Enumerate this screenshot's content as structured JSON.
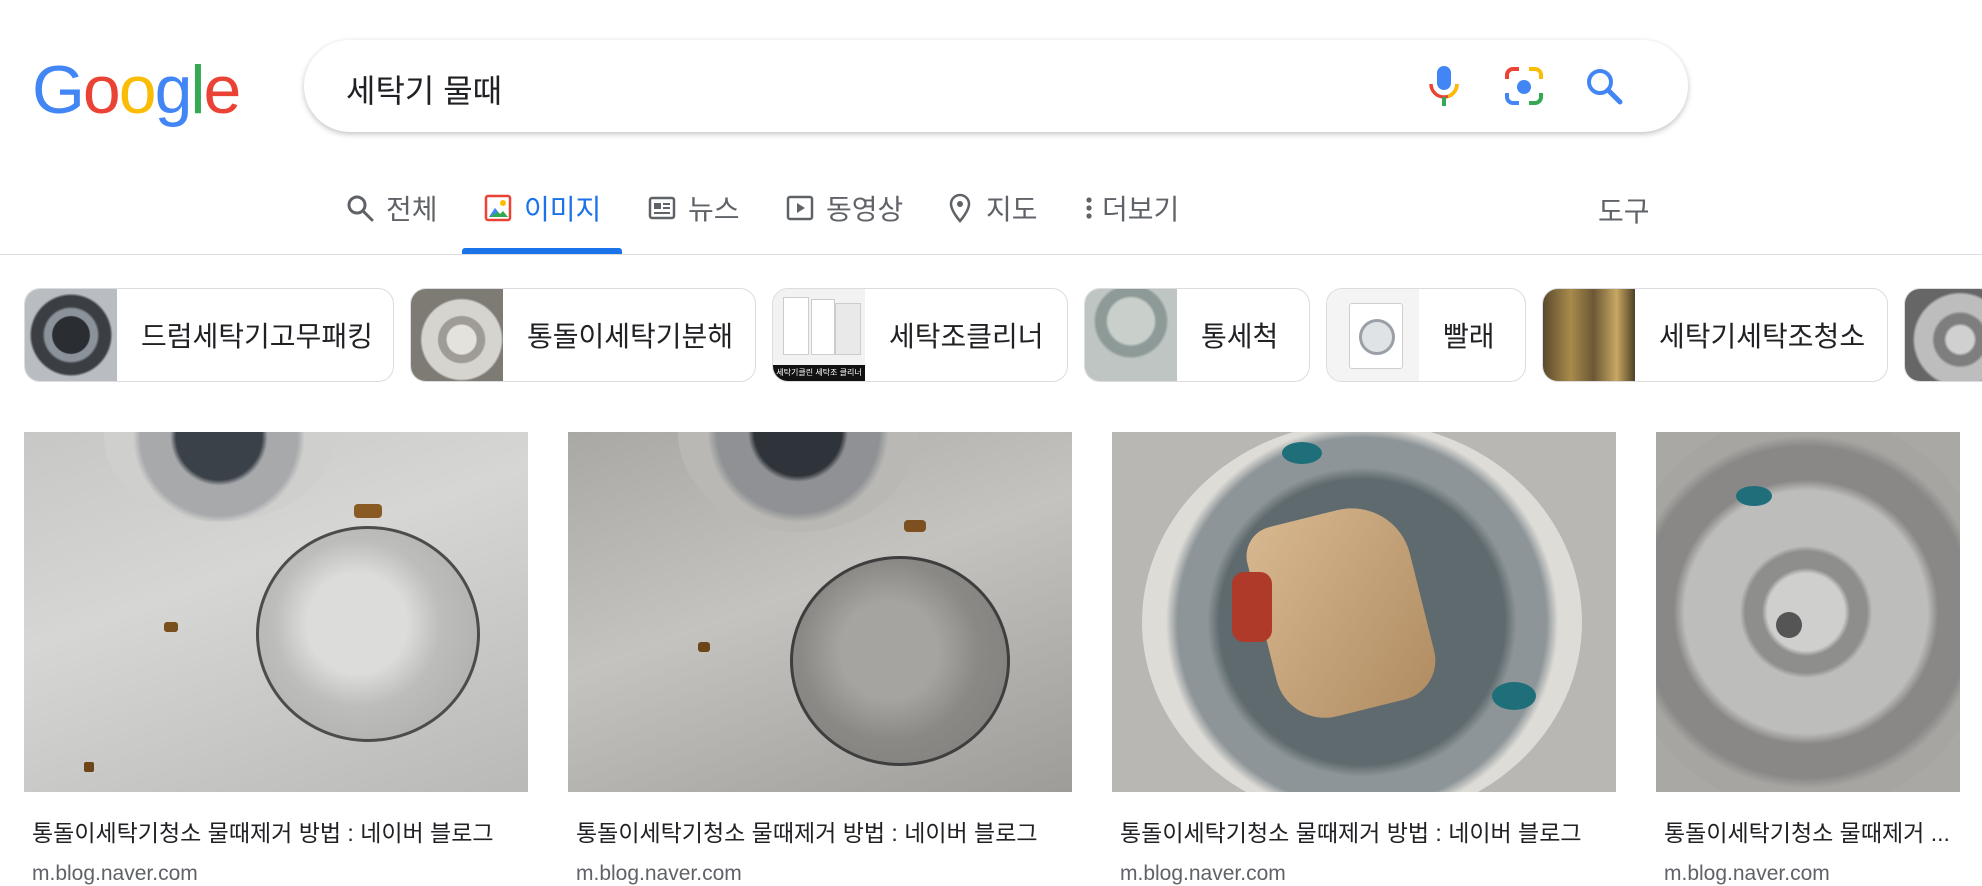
{
  "logo": {
    "letters": [
      "G",
      "o",
      "o",
      "g",
      "l",
      "e"
    ],
    "colors": [
      "#4285F4",
      "#EA4335",
      "#FBBC05",
      "#4285F4",
      "#34A853",
      "#EA4335"
    ]
  },
  "search": {
    "query": "세탁기 물때"
  },
  "icons": {
    "mic": "microphone-icon",
    "lens": "google-lens-icon",
    "search": "search-icon"
  },
  "tabs": [
    {
      "label": "전체",
      "icon": "search-icon"
    },
    {
      "label": "이미지",
      "icon": "image-icon",
      "active": true
    },
    {
      "label": "뉴스",
      "icon": "news-icon"
    },
    {
      "label": "동영상",
      "icon": "video-icon"
    },
    {
      "label": "지도",
      "icon": "map-pin-icon"
    },
    {
      "label": "더보기",
      "icon": "more-vert-icon"
    }
  ],
  "tools_label": "도구",
  "chips": [
    {
      "label": "드럼세탁기고무패킹"
    },
    {
      "label": "통돌이세탁기분해"
    },
    {
      "label": "세탁조클리너",
      "thumb_caption": "세탁기클린 세탁조 클리너"
    },
    {
      "label": "통세척"
    },
    {
      "label": "빨래"
    },
    {
      "label": "세탁기세탁조청소"
    }
  ],
  "results": [
    {
      "title": "통돌이세탁기청소 물때제거 방법 : 네이버 블로그",
      "source": "m.blog.naver.com"
    },
    {
      "title": "통돌이세탁기청소 물때제거 방법 : 네이버 블로그",
      "source": "m.blog.naver.com"
    },
    {
      "title": "통돌이세탁기청소 물때제거 방법 : 네이버 블로그",
      "source": "m.blog.naver.com"
    },
    {
      "title": "통돌이세탁기청소 물때제거 ...",
      "source": "m.blog.naver.com"
    }
  ],
  "colors": {
    "accent": "#1a73e8",
    "text": "#202124",
    "muted": "#5f6368",
    "border": "#dadce0"
  }
}
